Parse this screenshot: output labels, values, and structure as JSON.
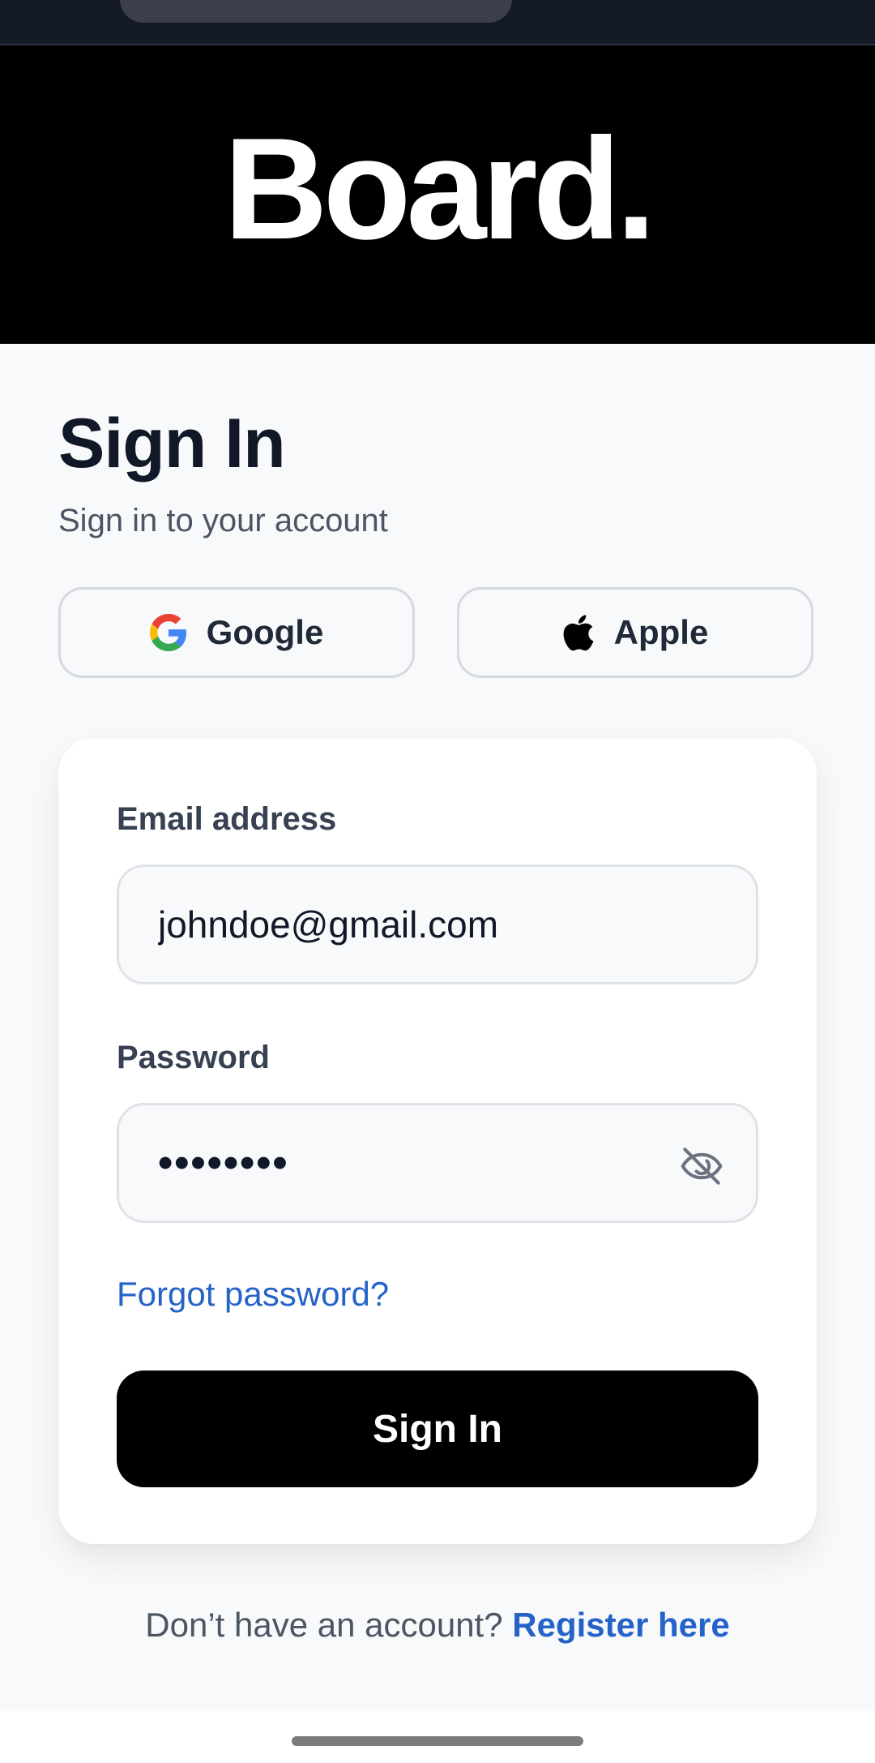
{
  "brand": {
    "logo_text": "Board."
  },
  "page": {
    "title": "Sign In",
    "subtitle": "Sign in to your account"
  },
  "social": {
    "google_label": "Google",
    "apple_label": "Apple"
  },
  "form": {
    "email_label": "Email address",
    "email_value": "johndoe@gmail.com",
    "password_label": "Password",
    "password_value": "••••••••",
    "forgot_link": "Forgot password?",
    "submit_label": "Sign In"
  },
  "footer": {
    "prompt_text": "Don’t have an account?",
    "register_link": "Register here"
  },
  "colors": {
    "accent_link": "#2563c9",
    "primary_button": "#000000",
    "header_background": "#000000",
    "page_background": "#f8f9fb"
  },
  "icons": {
    "google": "google-logo-icon",
    "apple": "apple-logo-icon",
    "password_toggle": "eye-off-icon"
  }
}
